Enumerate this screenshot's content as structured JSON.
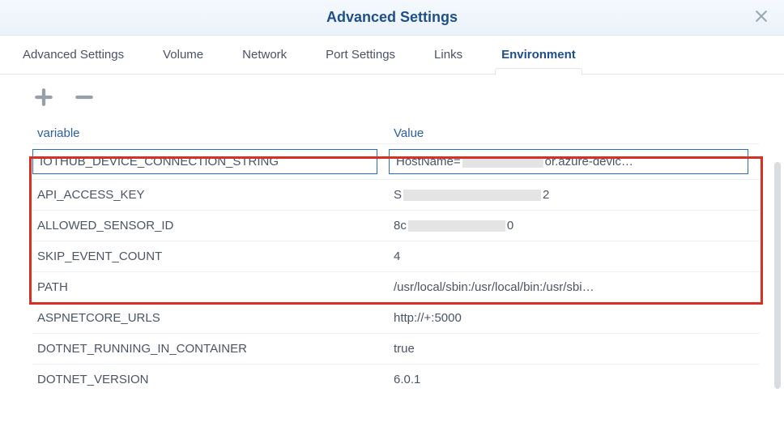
{
  "header": {
    "title": "Advanced Settings"
  },
  "tabs": [
    {
      "label": "Advanced Settings"
    },
    {
      "label": "Volume"
    },
    {
      "label": "Network"
    },
    {
      "label": "Port Settings"
    },
    {
      "label": "Links"
    },
    {
      "label": "Environment",
      "active": true
    }
  ],
  "columns": {
    "variable": "variable",
    "value": "Value"
  },
  "env_rows": [
    {
      "variable": "IOTHUB_DEVICE_CONNECTION_STRING",
      "value": "HostName=██████████or.azure-devic…",
      "selected": true,
      "highlighted": true
    },
    {
      "variable": "API_ACCESS_KEY",
      "value": "S███████████████2",
      "highlighted": true
    },
    {
      "variable": "ALLOWED_SENSOR_ID",
      "value": "8c██████████0",
      "highlighted": true
    },
    {
      "variable": "SKIP_EVENT_COUNT",
      "value": "4",
      "highlighted": true
    },
    {
      "variable": "PATH",
      "value": "/usr/local/sbin:/usr/local/bin:/usr/sbi…"
    },
    {
      "variable": "ASPNETCORE_URLS",
      "value": "http://+:5000"
    },
    {
      "variable": "DOTNET_RUNNING_IN_CONTAINER",
      "value": "true"
    },
    {
      "variable": "DOTNET_VERSION",
      "value": "6.0.1"
    }
  ],
  "icons": {
    "add": "plus-icon",
    "remove": "minus-icon",
    "close": "close-icon"
  }
}
